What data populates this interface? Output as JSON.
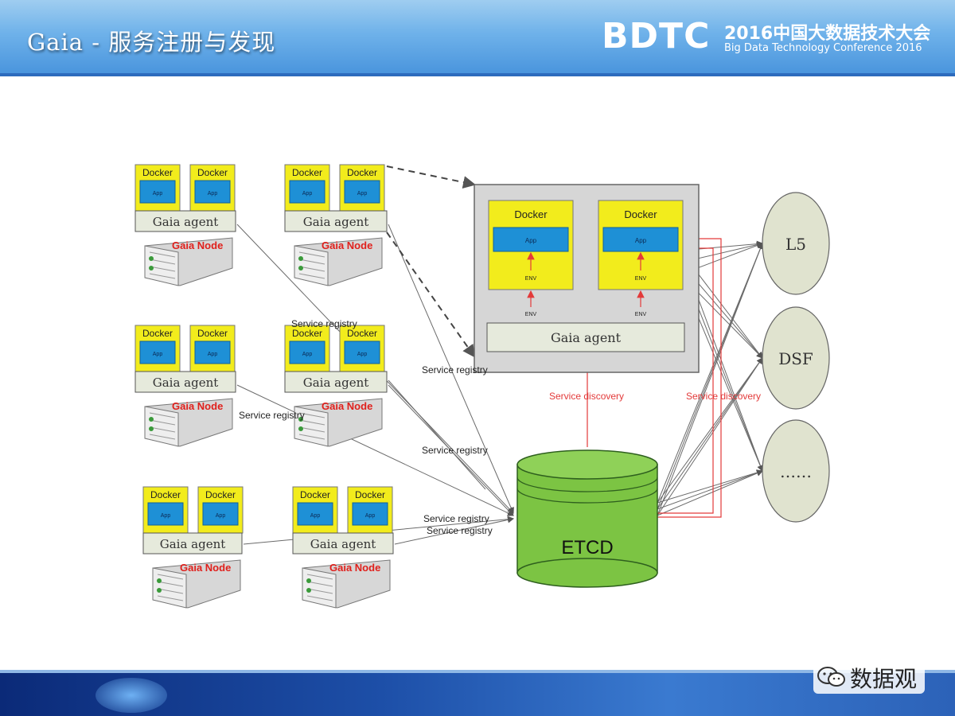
{
  "header": {
    "title": "Gaia - 服务注册与发现",
    "logo_text": "BDTC",
    "conference_cn": "2016中国大数据技术大会",
    "conference_en": "Big Data Technology Conference 2016"
  },
  "diagram": {
    "docker_label": "Docker",
    "app_label": "App",
    "agent_label": "Gaia agent",
    "node_label": "Gaia Node",
    "env_label": "ENV",
    "etcd_label": "ETCD",
    "registry_label": "Service registry",
    "discovery_label": "Service discovery",
    "consumers": [
      "L5",
      "DSF",
      "……"
    ]
  },
  "watermark": {
    "text": "数据观"
  },
  "colors": {
    "docker_fill": "#f2ec1c",
    "app_fill": "#1e90d6",
    "etcd_fill": "#7cc443",
    "node_label": "#e0201c",
    "discovery_line": "#e33a3a"
  }
}
